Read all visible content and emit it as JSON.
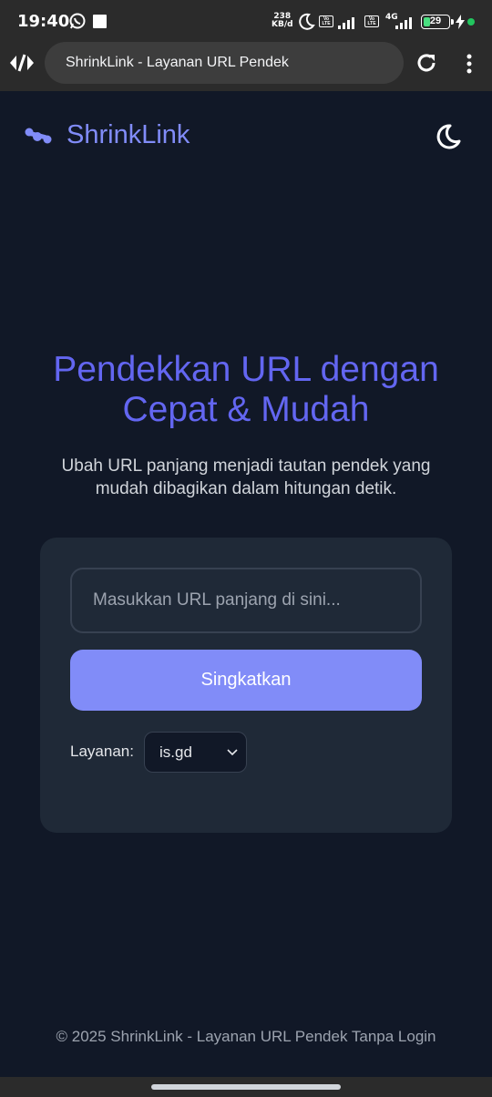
{
  "status_bar": {
    "time": "19:40",
    "net_speed_value": "238",
    "net_speed_unit": "KB/d",
    "volte_1": "Vo LTE",
    "volte_2": "Vo LTE",
    "network_type": "4G",
    "battery": "29",
    "battery_level": 0.29
  },
  "browser": {
    "tab_title": "ShrinkLink - Layanan URL Pendek"
  },
  "header": {
    "brand": "ShrinkLink"
  },
  "hero": {
    "title_line1": "Pendekkan URL dengan",
    "title_line2": "Cepat & Mudah",
    "subtitle_line1": "Ubah URL panjang menjadi tautan pendek yang",
    "subtitle_line2": "mudah dibagikan dalam hitungan detik."
  },
  "form": {
    "url_placeholder": "Masukkan URL panjang di sini...",
    "url_value": "",
    "submit_label": "Singkatkan",
    "service_label": "Layanan:",
    "service_selected": "is.gd"
  },
  "footer": {
    "text": "© 2025 ShrinkLink - Layanan URL Pendek Tanpa Login"
  },
  "colors": {
    "background": "#111827",
    "card": "#1f2937",
    "accent": "#818cf8",
    "title": "#6366f1"
  }
}
